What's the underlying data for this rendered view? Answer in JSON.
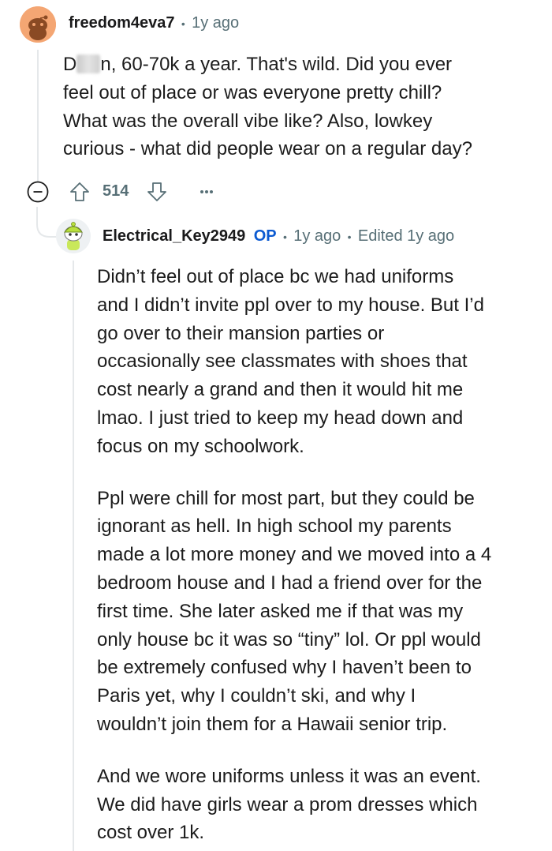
{
  "comment": {
    "username": "freedom4eva7",
    "time": "1y ago",
    "lines": [
      "n, 60-70k a year. That's wild. Did you ever",
      "feel out of place or was everyone pretty chill?",
      "What was the overall vibe like? Also, lowkey",
      "curious - what did people wear on a regular day?"
    ],
    "first_letter": "D",
    "votes": "514"
  },
  "reply": {
    "username": "Electrical_Key2949",
    "op_badge": "OP",
    "time": "1y ago",
    "edited": "Edited 1y ago",
    "paragraph1": [
      "Didn’t feel out of place bc we had uniforms",
      "and I didn’t invite ppl over to my house. But I’d",
      "go over to their mansion parties or",
      "occasionally see classmates with shoes that",
      "cost nearly a grand and then it would hit me",
      "lmao. I just tried to keep my head down and",
      "focus on my schoolwork."
    ],
    "paragraph2": [
      "Ppl were chill for most part, but they could be",
      "ignorant as hell. In high school my parents",
      "made a lot more money and we moved into a 4",
      "bedroom house and I had a friend over for the",
      "first time. She later asked me if that was my",
      "only house bc it was so “tiny” lol. Or ppl would",
      "be extremely confused why I haven’t been to",
      "Paris yet, why I couldn’t ski, and why I",
      "wouldn’t join them for a Hawaii senior trip."
    ],
    "paragraph3": [
      "And we wore uniforms unless it was an event.",
      "We did have girls wear a prom dresses which",
      "cost over 1k."
    ]
  },
  "icons": {
    "collapse": "collapse-icon",
    "upvote": "upvote-icon",
    "downvote": "downvote-icon",
    "more": "more-options-icon"
  },
  "colors": {
    "op": "#0b5ad1",
    "meta": "#576f76",
    "avatar1": "#f2a06b",
    "avatar2": "#c6e85a"
  }
}
